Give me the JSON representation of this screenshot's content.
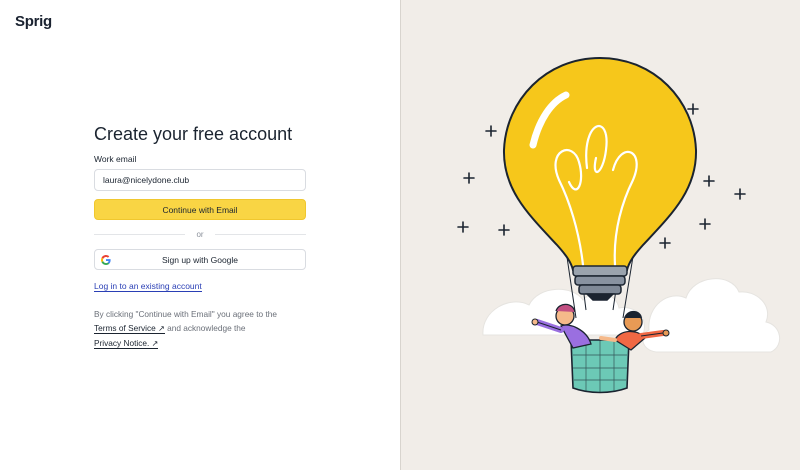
{
  "brand": {
    "logo_text": "Sprig"
  },
  "signup": {
    "title": "Create your free account",
    "email_label": "Work email",
    "email_value": "laura@nicelydone.club",
    "continue_button": "Continue with Email",
    "or_text": "or",
    "google_button": "Sign up with Google",
    "login_link": "Log in to an existing account"
  },
  "legal": {
    "prefix": "By clicking \"Continue with Email\" you agree to the",
    "terms_link": "Terms of Service",
    "middle": "and acknowledge the",
    "privacy_link": "Privacy Notice.",
    "arrow": "↗"
  },
  "colors": {
    "accent_yellow": "#f9d544",
    "link_blue": "#2a3fb5",
    "illustration_bg": "#f1ede8"
  },
  "icons": [
    "google-icon",
    "external-link-icon",
    "lightbulb-balloon-illustration"
  ]
}
